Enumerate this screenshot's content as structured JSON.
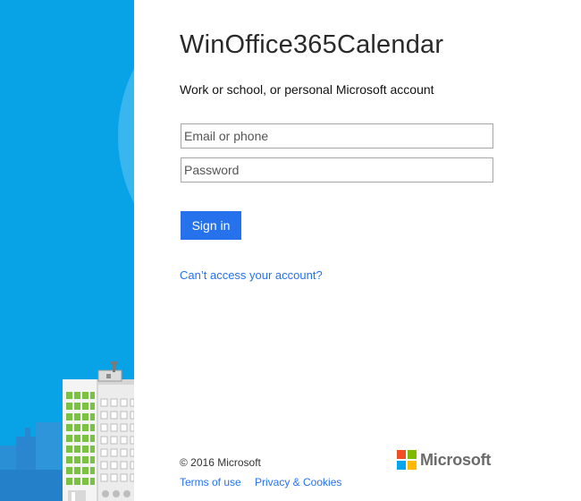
{
  "window": {
    "app_title": "WinOffice365Calendar",
    "subtitle": "Work or school, or personal Microsoft account"
  },
  "form": {
    "email_placeholder": "Email or phone",
    "email_value": "",
    "password_placeholder": "Password",
    "password_value": "",
    "signin_label": "Sign in",
    "cant_access_label": "Can’t access your account?"
  },
  "footer": {
    "copyright": "© 2016 Microsoft",
    "terms_label": "Terms of use",
    "privacy_label": "Privacy & Cookies",
    "brand_name": "Microsoft"
  },
  "colors": {
    "side_panel": "#08a3e6",
    "accent": "#2672ec",
    "logo_red": "#f25022",
    "logo_green": "#7fba00",
    "logo_blue": "#00a4ef",
    "logo_yellow": "#ffb900"
  },
  "icons": {
    "side_art": "city-skyline-illustration",
    "brand": "microsoft-logo-icon"
  }
}
